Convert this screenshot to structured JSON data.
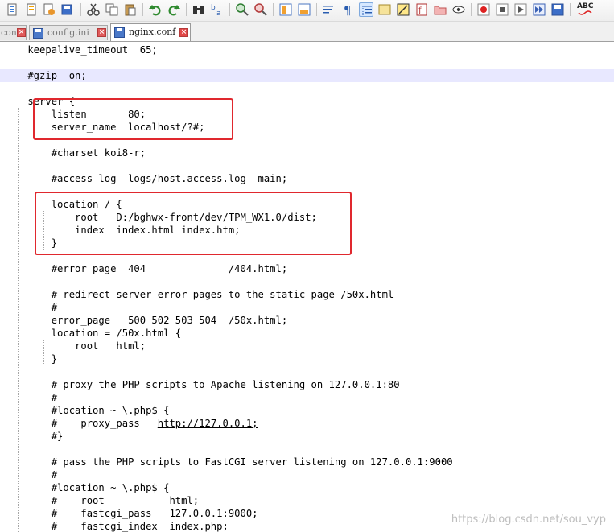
{
  "toolbar": {
    "spell_check_label": "ABC",
    "tools": [
      "new-file",
      "open-file",
      "save",
      "save-all",
      "close",
      "close-all",
      "print",
      "cut",
      "copy",
      "paste",
      "undo",
      "redo",
      "find",
      "replace",
      "zoom-in",
      "zoom-out",
      "sync-vertical",
      "sync-horizontal",
      "word-wrap",
      "show-all-chars",
      "indent-guide",
      "user-defined-language",
      "document-map",
      "function-list",
      "folder-as-workspace",
      "monitoring",
      "record-macro",
      "stop-recording",
      "playback-macro",
      "run-macro-multiple",
      "save-macro",
      "spell-check"
    ]
  },
  "tabs": [
    {
      "label": "conf",
      "active": false
    },
    {
      "label": "config.ini",
      "active": false
    },
    {
      "label": "nginx.conf",
      "active": true
    }
  ],
  "editor": {
    "lines": [
      "    keepalive_timeout  65;",
      "",
      "    #gzip  on;",
      "",
      "    server {",
      "        listen       80;",
      "        server_name  localhost/?#;",
      "",
      "        #charset koi8-r;",
      "",
      "        #access_log  logs/host.access.log  main;",
      "",
      "        location / {",
      "            root   D:/bghwx-front/dev/TPM_WX1.0/dist;",
      "            index  index.html index.htm;",
      "        }",
      "",
      "        #error_page  404              /404.html;",
      "",
      "        # redirect server error pages to the static page /50x.html",
      "        #",
      "        error_page   500 502 503 504  /50x.html;",
      "        location = /50x.html {",
      "            root   html;",
      "        }",
      "",
      "        # proxy the PHP scripts to Apache listening on 127.0.0.1:80",
      "        #",
      "        #location ~ \\.php$ {",
      "        #    proxy_pass   http://127.0.0.1;",
      "        #}",
      "",
      "        # pass the PHP scripts to FastCGI server listening on 127.0.0.1:9000",
      "        #",
      "        #location ~ \\.php$ {",
      "        #    root           html;",
      "        #    fastcgi_pass   127.0.0.1:9000;",
      "        #    fastcgi_index  index.php;"
    ],
    "current_line": 2,
    "link_text": "http://127.0.0.1;"
  },
  "watermark": "https://blog.csdn.net/sou_vyp",
  "colors": {
    "highlight_box": "#e0282e",
    "current_line": "#e8e8ff",
    "close_button": "#e05b5b"
  }
}
